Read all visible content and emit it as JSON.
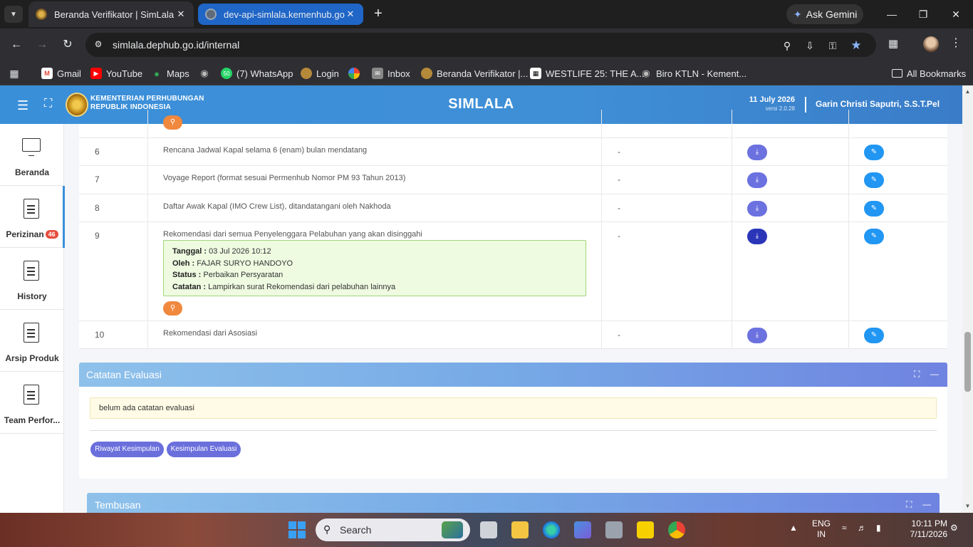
{
  "browser": {
    "tabs": [
      {
        "title": "Beranda Verifikator | SimLala",
        "active": true
      },
      {
        "title": "dev-api-simlala.kemenhub.go.id",
        "active": false
      }
    ],
    "new_tab_icon": "plus-icon",
    "ask_gemini": "Ask Gemini",
    "url": "simlala.dephub.go.id/internal",
    "bookmarks": [
      {
        "label": "Gmail",
        "icon": "gmail-icon"
      },
      {
        "label": "YouTube",
        "icon": "youtube-icon"
      },
      {
        "label": "Maps",
        "icon": "maps-icon"
      },
      {
        "label": "",
        "icon": "globe-icon"
      },
      {
        "label": "(7) WhatsApp",
        "icon": "whatsapp-icon",
        "badge": "50"
      },
      {
        "label": "Login",
        "icon": "emblem-icon"
      },
      {
        "label": "",
        "icon": "pinwheel-icon"
      },
      {
        "label": "Inbox",
        "icon": "mail-icon"
      },
      {
        "label": "Beranda Verifikator |...",
        "icon": "emblem-icon"
      },
      {
        "label": "WESTLIFE 25: THE A...",
        "icon": "bookmark-icon"
      },
      {
        "label": "Biro KTLN - Kement...",
        "icon": "globe-icon"
      }
    ],
    "all_bookmarks": "All Bookmarks"
  },
  "app": {
    "logo_line1": "KEMENTERIAN PERHUBUNGAN",
    "logo_line2": "REPUBLIK INDONESIA",
    "title": "SIMLALA",
    "date": "11 July 2026",
    "version": "versi 2.0.28",
    "user": "Garin Christi Saputri, S.S.T.Pel"
  },
  "sidebar": {
    "items": [
      {
        "label": "Beranda",
        "icon": "monitor-icon"
      },
      {
        "label": "Perizinan",
        "icon": "document-icon",
        "badge": "46"
      },
      {
        "label": "History",
        "icon": "document-icon"
      },
      {
        "label": "Arsip Produk",
        "icon": "document-icon"
      },
      {
        "label": "Team Perfor...",
        "icon": "document-icon"
      }
    ]
  },
  "table": {
    "rows": [
      {
        "no": "6",
        "doc": "Rencana Jadwal Kapal selama 6 (enam) bulan mendatang",
        "value": "-"
      },
      {
        "no": "7",
        "doc": "Voyage Report (format sesuai Permenhub Nomor PM 93 Tahun 2013)",
        "value": "-"
      },
      {
        "no": "8",
        "doc": "Daftar Awak Kapal (IMO Crew List), ditandatangani oleh Nakhoda",
        "value": "-"
      },
      {
        "no": "9",
        "doc": "Rekomendasi dari semua Penyelenggara Pelabuhan yang akan disinggahi",
        "value": "-",
        "note": {
          "tanggal_label": "Tanggal :",
          "tanggal": "03 Jul 2026 10:12",
          "oleh_label": "Oleh :",
          "oleh": "FAJAR SURYO HANDOYO",
          "status_label": "Status :",
          "status": "Perbaikan Persyaratan",
          "catatan_label": "Catatan :",
          "catatan": "Lampirkan surat Rekomendasi dari pelabuhan lainnya"
        }
      },
      {
        "no": "10",
        "doc": "Rekomendasi dari Asosiasi",
        "value": "-"
      }
    ]
  },
  "catatan_evaluasi": {
    "title": "Catatan Evaluasi",
    "empty_text": "belum ada catatan evaluasi",
    "btn_riwayat": "Riwayat Kesimpulan",
    "btn_kesimpulan": "Kesimpulan Evaluasi"
  },
  "tembusan": {
    "title": "Tembusan"
  },
  "taskbar": {
    "search": "Search",
    "lang_line1": "ENG",
    "lang_line2": "IN",
    "time": "10:11 PM",
    "date": "7/11/2026"
  }
}
